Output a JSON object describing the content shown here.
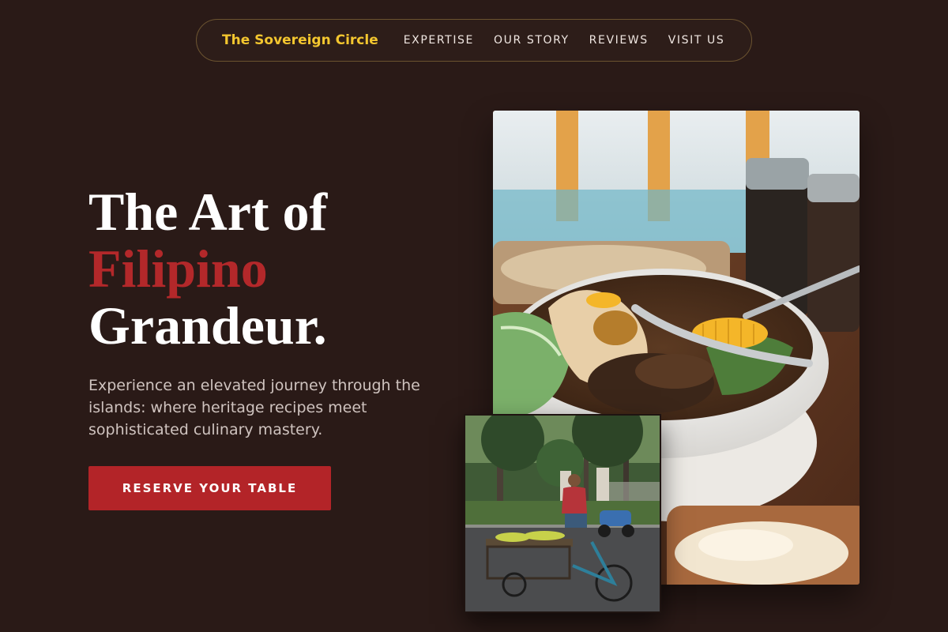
{
  "nav": {
    "brand": "The Sovereign Circle",
    "links": [
      {
        "label": "EXPERTISE"
      },
      {
        "label": "OUR STORY"
      },
      {
        "label": "REVIEWS"
      },
      {
        "label": "VISIT US"
      }
    ]
  },
  "hero": {
    "title_line1": "The Art of",
    "title_line2": "Filipino",
    "title_line3": "Grandeur.",
    "description": "Experience an elevated journey through the islands: where heritage recipes meet sophisticated culinary mastery.",
    "cta_label": "RESERVE YOUR TABLE"
  },
  "colors": {
    "background": "#2a1a17",
    "brand": "#f3c62f",
    "accent": "#b3282a"
  },
  "images": {
    "main": "bulalo-soup-bowl-photo",
    "secondary": "street-vendor-tricycle-photo"
  }
}
